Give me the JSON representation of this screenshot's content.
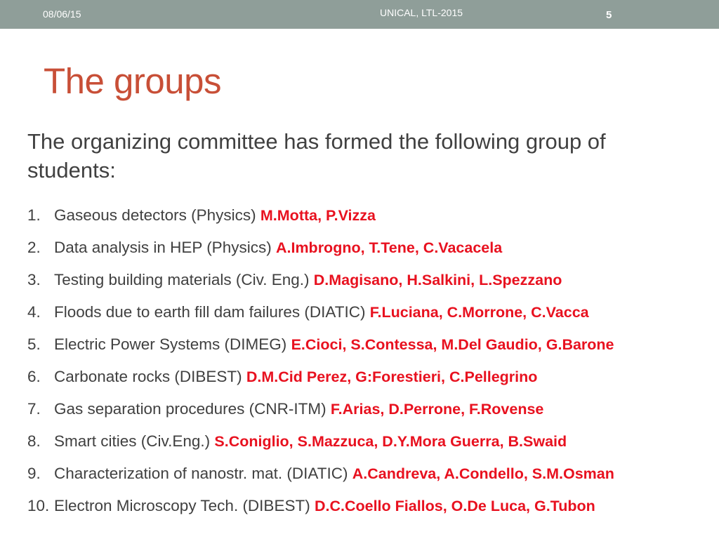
{
  "header": {
    "date": "08/06/15",
    "footer": "UNICAL, LTL-2015",
    "slide_number": "5"
  },
  "slide": {
    "title": "The groups",
    "intro": "The organizing committee has formed the following group of students:",
    "groups": [
      {
        "number": "1.",
        "topic": "Gaseous detectors (Physics)",
        "members": "M.Motta, P.Vizza"
      },
      {
        "number": "2.",
        "topic": "Data analysis in HEP (Physics)",
        "members": "A.Imbrogno, T.Tene, C.Vacacela"
      },
      {
        "number": "3.",
        "topic": "Testing building materials (Civ. Eng.)",
        "members": "D.Magisano, H.Salkini, L.Spezzano"
      },
      {
        "number": "4.",
        "topic": "Floods due to earth fill dam failures (DIATIC)",
        "members": "F.Luciana, C.Morrone, C.Vacca"
      },
      {
        "number": "5.",
        "topic": "Electric Power Systems (DIMEG)",
        "members": "E.Cioci, S.Contessa, M.Del Gaudio, G.Barone"
      },
      {
        "number": "6.",
        "topic": "Carbonate rocks (DIBEST)",
        "members": "D.M.Cid Perez, G:Forestieri, C.Pellegrino"
      },
      {
        "number": "7.",
        "topic": "Gas separation procedures (CNR-ITM)",
        "members": "F.Arias, D.Perrone, F.Rovense"
      },
      {
        "number": "8.",
        "topic": "Smart cities (Civ.Eng.)",
        "members": "S.Coniglio, S.Mazzuca, D.Y.Mora Guerra, B.Swaid"
      },
      {
        "number": "9.",
        "topic": "Characterization of nanostr. mat. (DIATIC)",
        "members": "A.Candreva, A.Condello, S.M.Osman"
      },
      {
        "number": "10.",
        "topic": "Electron Microscopy Tech. (DIBEST)",
        "members": "D.C.Coello Fiallos, O.De Luca, G.Tubon"
      }
    ]
  },
  "colors": {
    "header_bar": "#8f9e99",
    "title": "#c84f37",
    "members": "#e8111f",
    "body_text": "#404040"
  }
}
